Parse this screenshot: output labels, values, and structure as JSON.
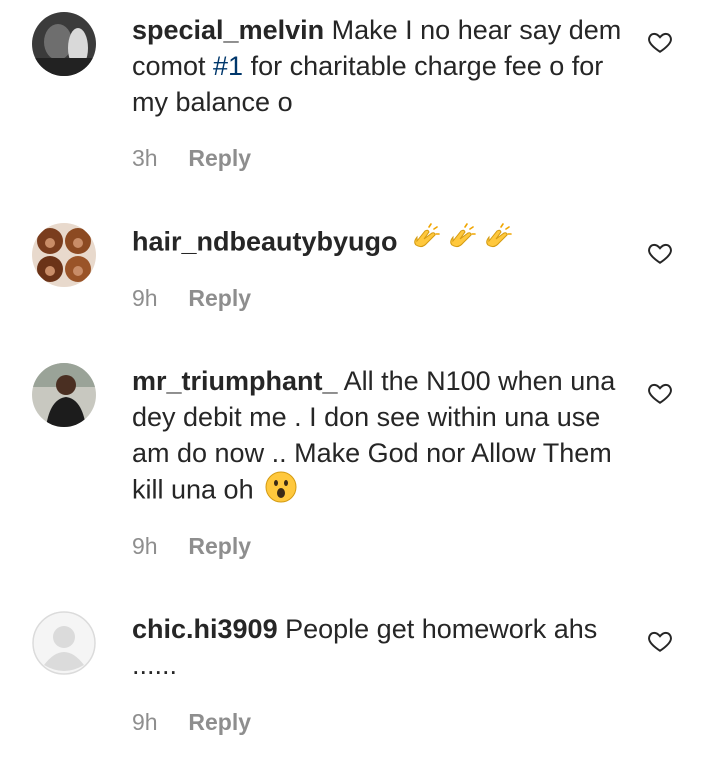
{
  "comments": [
    {
      "username": "special_melvin",
      "text_before": "Make I no hear say dem comot ",
      "hashtag": "#1",
      "text_after": " for charitable charge fee o for my balance o",
      "time": "3h",
      "reply_label": "Reply",
      "avatar_icon": "avatar-photo"
    },
    {
      "username": "hair_ndbeautybyugo",
      "text": "",
      "emojis": [
        "clapping-hands",
        "clapping-hands",
        "clapping-hands"
      ],
      "time": "9h",
      "reply_label": "Reply",
      "avatar_icon": "avatar-photo"
    },
    {
      "username": "mr_triumphant_",
      "text": "All the N100 when una dey debit me . I don see within una use am do now .. Make God nor Allow Them kill una oh",
      "emojis": [
        "astonished-face"
      ],
      "time": "9h",
      "reply_label": "Reply",
      "avatar_icon": "avatar-photo"
    },
    {
      "username": "chic.hi3909",
      "text": "People get homework ahs ......",
      "time": "9h",
      "reply_label": "Reply",
      "avatar_icon": "default-avatar"
    }
  ],
  "colors": {
    "text": "#262626",
    "meta": "#8e8e8e",
    "hashtag": "#00376b",
    "emoji_yellow": "#ffc83d"
  }
}
